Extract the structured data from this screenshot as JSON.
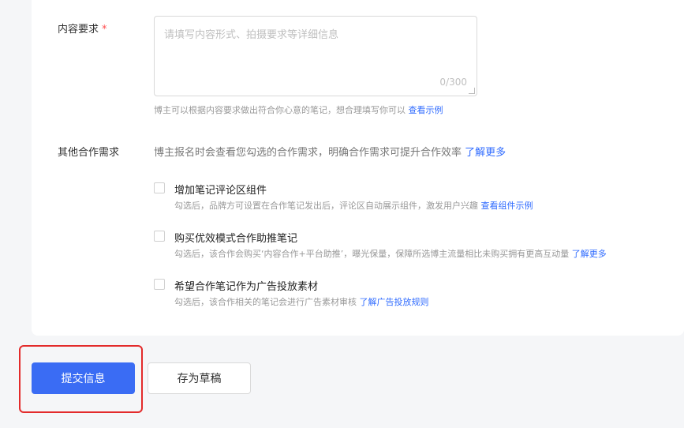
{
  "content_req": {
    "label": "内容要求",
    "required_mark": "*",
    "placeholder": "请填写内容形式、拍摄要求等详细信息",
    "counter": "0/300",
    "help_text": "博主可以根据内容要求做出符合你心意的笔记，想合理填写你可以",
    "help_link": "查看示例"
  },
  "other_req": {
    "label": "其他合作需求",
    "intro": "博主报名时会查看您勾选的合作需求，明确合作需求可提升合作效率",
    "intro_link": "了解更多",
    "options": [
      {
        "title": "增加笔记评论区组件",
        "desc": "勾选后，品牌方可设置在合作笔记发出后，评论区自动展示组件，激发用户兴趣",
        "link": "查看组件示例",
        "checked": false
      },
      {
        "title": "购买优效模式合作助推笔记",
        "desc": "勾选后，该合作会购买‘内容合作+平台助推’，曝光保量，保障所选博主流量相比未购买拥有更高互动量",
        "link": "了解更多",
        "checked": false
      },
      {
        "title": "希望合作笔记作为广告投放素材",
        "desc": "勾选后，该合作相关的笔记会进行广告素材审核",
        "link": "了解广告投放规则",
        "checked": false
      }
    ]
  },
  "actions": {
    "submit_label": "提交信息",
    "draft_label": "存为草稿"
  },
  "colors": {
    "primary": "#3a6cf4",
    "link": "#2f6bff",
    "required": "#ff4d4f",
    "highlight": "#e32b2b"
  }
}
